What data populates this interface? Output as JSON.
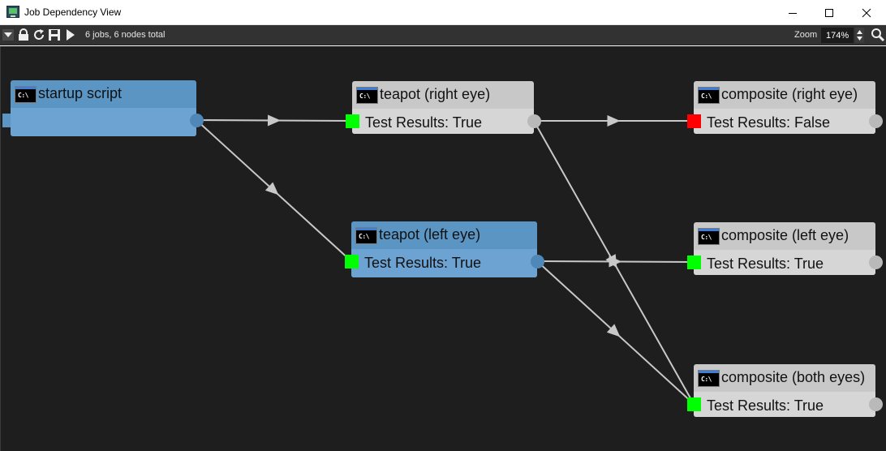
{
  "window": {
    "title": "Job Dependency View"
  },
  "toolbar": {
    "status": "6 jobs, 6 nodes total",
    "zoom_label": "Zoom",
    "zoom_value": "174%"
  },
  "icons": {
    "app": "monitor-icon",
    "menu": "dropdown-triangle-icon",
    "lock": "lock-icon",
    "refresh": "refresh-icon",
    "save": "save-icon",
    "play": "play-icon",
    "spin": "spinner-arrows-icon",
    "search": "magnifier-icon",
    "node": "command-prompt-icon"
  },
  "cmd_glyph": "C:\\",
  "colors": {
    "pass": "#00ff00",
    "fail": "#ff0000",
    "selected": "#5b95c4",
    "node": "#c8c8c8",
    "edge": "#c8c8c8"
  },
  "nodes": [
    {
      "id": "startup",
      "title": "startup script",
      "result": "",
      "status": "none",
      "selected": true
    },
    {
      "id": "teapot_right",
      "title": "teapot (right eye)",
      "result": "Test Results: True",
      "status": "pass",
      "selected": false
    },
    {
      "id": "teapot_left",
      "title": "teapot (left eye)",
      "result": "Test Results: True",
      "status": "pass",
      "selected": true
    },
    {
      "id": "comp_right",
      "title": "composite (right eye)",
      "result": "Test Results: False",
      "status": "fail",
      "selected": false
    },
    {
      "id": "comp_left",
      "title": "composite (left eye)",
      "result": "Test Results: True",
      "status": "pass",
      "selected": false
    },
    {
      "id": "comp_both",
      "title": "composite (both eyes)",
      "result": "Test Results: True",
      "status": "pass",
      "selected": false
    }
  ],
  "edges": [
    {
      "from": "startup",
      "to": "teapot_right"
    },
    {
      "from": "startup",
      "to": "teapot_left"
    },
    {
      "from": "teapot_right",
      "to": "comp_right"
    },
    {
      "from": "teapot_right",
      "to": "comp_both"
    },
    {
      "from": "teapot_left",
      "to": "comp_left"
    },
    {
      "from": "teapot_left",
      "to": "comp_both"
    }
  ]
}
